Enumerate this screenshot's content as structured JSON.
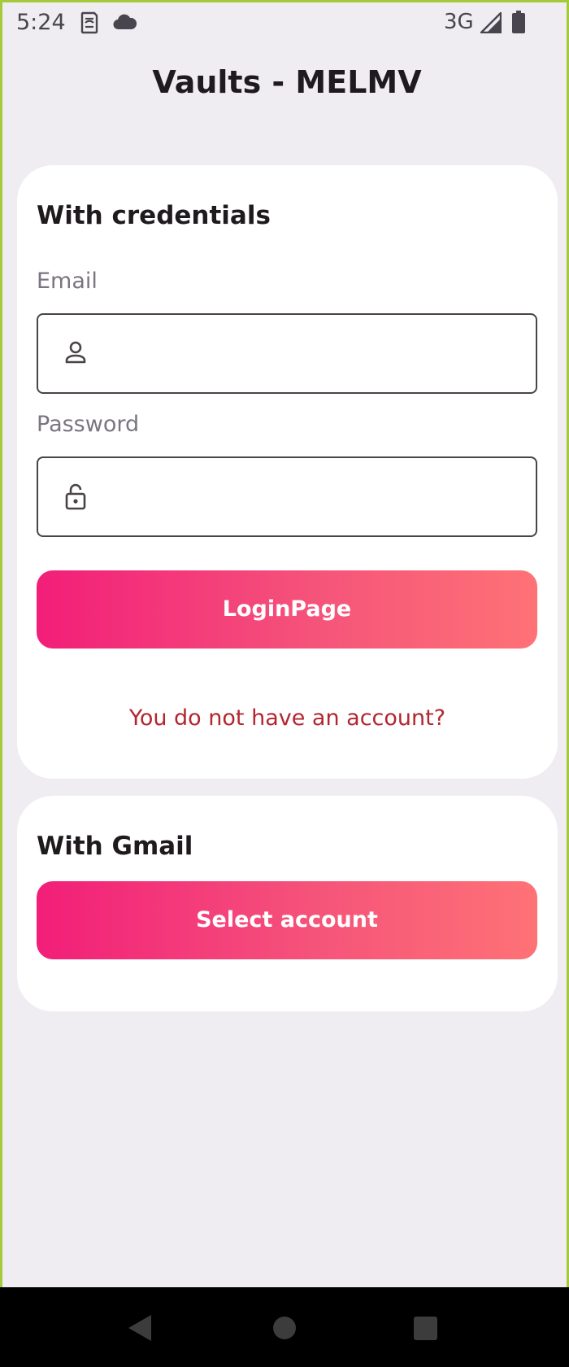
{
  "status_bar": {
    "time": "5:24",
    "network": "3G",
    "icons": [
      "sim-card-icon",
      "cloud-icon",
      "signal-icon",
      "battery-icon"
    ]
  },
  "header": {
    "title": "Vaults - MELMV"
  },
  "credentials_card": {
    "heading": "With credentials",
    "email_label": "Email",
    "email_value": "",
    "email_icon": "person-icon",
    "password_label": "Password",
    "password_value": "",
    "password_icon": "lock-icon",
    "login_label": "LoginPage",
    "register_link": "You do not have an account?"
  },
  "gmail_card": {
    "heading": "With Gmail",
    "select_label": "Select account"
  },
  "nav_bar": {
    "icons": [
      "back-icon",
      "home-icon",
      "recents-icon"
    ]
  },
  "colors": {
    "background": "#efedf1",
    "card": "#ffffff",
    "gradient_start": "#f21e79",
    "gradient_end": "#fe7276",
    "link": "#b3262f",
    "frame_border": "#a4c93a"
  }
}
